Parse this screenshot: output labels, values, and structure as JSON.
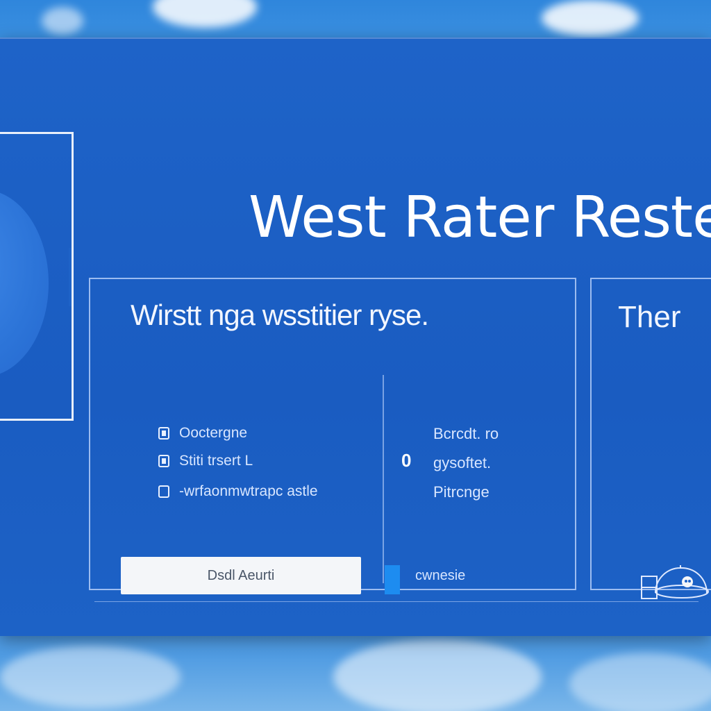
{
  "window": {
    "title": "West Rater Reste"
  },
  "main_card": {
    "heading": "Wirstt nga wsstitier ryse.",
    "options": [
      {
        "label": "Ooctergne"
      },
      {
        "label": "Stiti trsert L"
      },
      {
        "label": "-wrfaonmwtrapc astle"
      }
    ],
    "right_column": [
      {
        "label": "Bcrcdt. ro"
      },
      {
        "label": "gysoftet."
      },
      {
        "label": "Pitrcnge"
      }
    ],
    "zero_value": "0",
    "primary_button_label": "Dsdl Aeurti",
    "status_label": "cwnesie"
  },
  "side_card": {
    "heading": "Ther"
  },
  "colors": {
    "window_bg": "#1e63c8",
    "accent": "#1d8cf0",
    "button_bg": "#f4f6f9"
  }
}
